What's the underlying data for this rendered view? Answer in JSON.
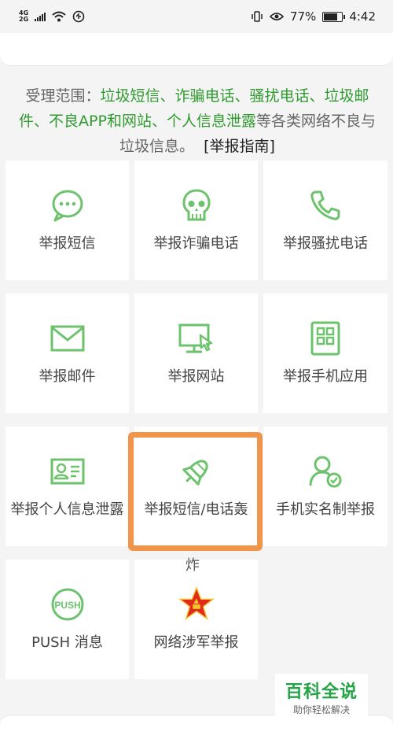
{
  "status_bar": {
    "network_top": "4G",
    "network_bottom": "2G",
    "battery": "77%",
    "time": "4:42"
  },
  "scope": {
    "prefix": "受理范围：",
    "highlighted": "垃圾短信、诈骗电话、骚扰电话、垃圾邮件、不良APP和网站、个人信息泄露",
    "suffix": "等各类网络不良与垃圾信息。",
    "guide_link": "[举报指南]"
  },
  "tiles": [
    {
      "label": "举报短信",
      "icon": "sms-bubble-icon"
    },
    {
      "label": "举报诈骗电话",
      "icon": "skull-icon"
    },
    {
      "label": "举报骚扰电话",
      "icon": "phone-icon"
    },
    {
      "label": "举报邮件",
      "icon": "mail-icon"
    },
    {
      "label": "举报网站",
      "icon": "monitor-cursor-icon"
    },
    {
      "label": "举报手机应用",
      "icon": "phone-apps-icon"
    },
    {
      "label": "举报个人信息泄露",
      "icon": "id-card-icon"
    },
    {
      "label": "举报短信/电话轰",
      "label_overflow": "炸",
      "icon": "bomb-icon"
    },
    {
      "label": "手机实名制举报",
      "icon": "user-check-icon"
    },
    {
      "label": "PUSH 消息",
      "icon": "push-icon",
      "icon_text": "PUSH"
    },
    {
      "label": "网络涉军举报",
      "icon": "red-star-icon"
    }
  ],
  "colors": {
    "icon_green": "#6cc36c",
    "text_green": "#2f9a2f",
    "highlight_orange": "#f0954a",
    "star_red": "#e02a1b",
    "star_gold": "#f4c531"
  },
  "watermark": {
    "title": "百科全说",
    "subtitle": "助你轻松解决"
  }
}
